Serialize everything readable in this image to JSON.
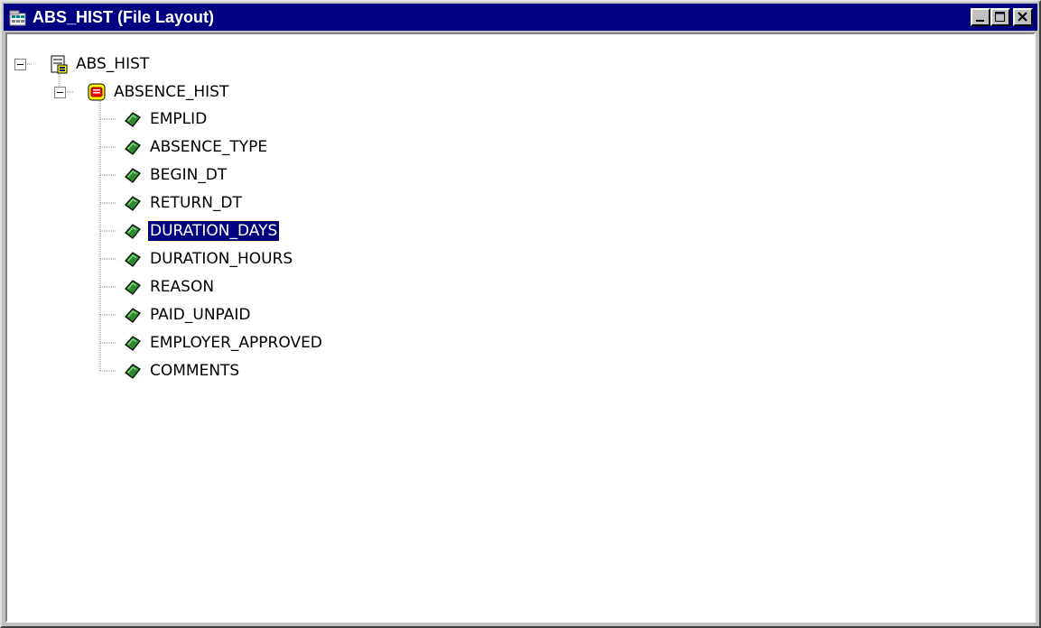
{
  "window": {
    "title": "ABS_HIST (File Layout)",
    "buttons": {
      "minimize": "minimize-icon",
      "maximize": "maximize-icon",
      "close": "close-icon"
    }
  },
  "tree": {
    "root": {
      "label": "ABS_HIST",
      "icon": "file-layout-icon",
      "expanded": true
    },
    "record": {
      "label": "ABSENCE_HIST",
      "icon": "record-icon",
      "expanded": true
    },
    "fields": [
      {
        "label": "EMPLID",
        "selected": false
      },
      {
        "label": "ABSENCE_TYPE",
        "selected": false
      },
      {
        "label": "BEGIN_DT",
        "selected": false
      },
      {
        "label": "RETURN_DT",
        "selected": false
      },
      {
        "label": "DURATION_DAYS",
        "selected": true
      },
      {
        "label": "DURATION_HOURS",
        "selected": false
      },
      {
        "label": "REASON",
        "selected": false
      },
      {
        "label": "PAID_UNPAID",
        "selected": false
      },
      {
        "label": "EMPLOYER_APPROVED",
        "selected": false
      },
      {
        "label": "COMMENTS",
        "selected": false
      }
    ],
    "field_icon": "field-icon"
  },
  "colors": {
    "titlebar": "#000080",
    "selection": "#000080",
    "window_face": "#c0c0c0",
    "field_icon_green": "#2e8b2e"
  }
}
